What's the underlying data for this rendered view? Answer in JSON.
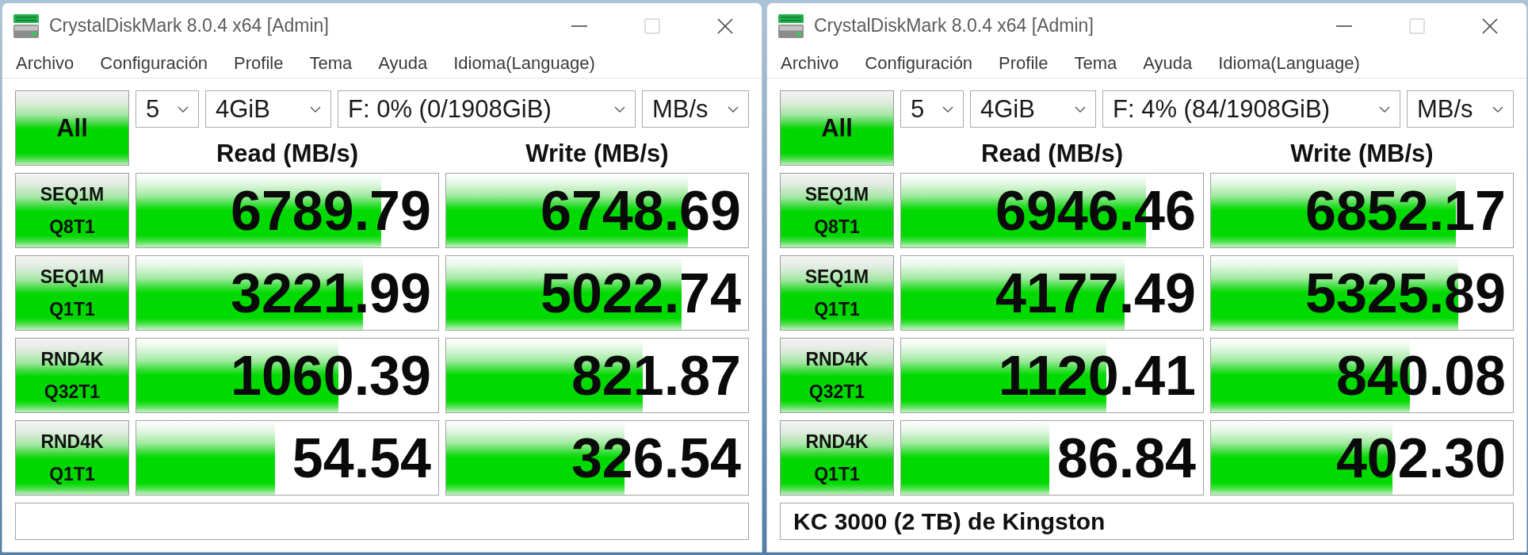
{
  "windows": [
    {
      "title": "CrystalDiskMark 8.0.4 x64 [Admin]",
      "controls": [
        {
          "kind": "minimize",
          "disabled": false
        },
        {
          "kind": "maximize",
          "disabled": true
        },
        {
          "kind": "close",
          "disabled": false
        }
      ],
      "menu": [
        "Archivo",
        "Configuración",
        "Profile",
        "Tema",
        "Ayuda",
        "Idioma(Language)"
      ],
      "all_button": "All",
      "settings": [
        {
          "kind": "count",
          "value": "5"
        },
        {
          "kind": "size",
          "value": "4GiB"
        },
        {
          "kind": "drive",
          "value": "F: 0% (0/1908GiB)"
        },
        {
          "kind": "unit",
          "value": "MB/s"
        }
      ],
      "columns": [
        "Read (MB/s)",
        "Write (MB/s)"
      ],
      "tests": [
        {
          "name": "SEQ1M",
          "params": "Q8T1",
          "read": {
            "value": "6789.79",
            "level": 0.81
          },
          "write": {
            "value": "6748.69",
            "level": 0.8
          }
        },
        {
          "name": "SEQ1M",
          "params": "Q1T1",
          "read": {
            "value": "3221.99",
            "level": 0.75
          },
          "write": {
            "value": "5022.74",
            "level": 0.78
          }
        },
        {
          "name": "RND4K",
          "params": "Q32T1",
          "read": {
            "value": "1060.39",
            "level": 0.67
          },
          "write": {
            "value": "821.87",
            "level": 0.65
          }
        },
        {
          "name": "RND4K",
          "params": "Q1T1",
          "read": {
            "value": "54.54",
            "level": 0.46
          },
          "write": {
            "value": "326.54",
            "level": 0.59
          }
        }
      ]
    },
    {
      "title": "CrystalDiskMark 8.0.4 x64 [Admin]",
      "controls": [
        {
          "kind": "minimize",
          "disabled": false
        },
        {
          "kind": "maximize",
          "disabled": true
        },
        {
          "kind": "close",
          "disabled": false
        }
      ],
      "menu": [
        "Archivo",
        "Configuración",
        "Profile",
        "Tema",
        "Ayuda",
        "Idioma(Language)"
      ],
      "all_button": "All",
      "settings": [
        {
          "kind": "count",
          "value": "5"
        },
        {
          "kind": "size",
          "value": "4GiB"
        },
        {
          "kind": "drive",
          "value": "F: 4% (84/1908GiB)"
        },
        {
          "kind": "unit",
          "value": "MB/s"
        }
      ],
      "columns": [
        "Read (MB/s)",
        "Write (MB/s)"
      ],
      "tests": [
        {
          "name": "SEQ1M",
          "params": "Q8T1",
          "read": {
            "value": "6946.46",
            "level": 0.81
          },
          "write": {
            "value": "6852.17",
            "level": 0.81
          }
        },
        {
          "name": "SEQ1M",
          "params": "Q1T1",
          "read": {
            "value": "4177.49",
            "level": 0.74
          },
          "write": {
            "value": "5325.89",
            "level": 0.82
          }
        },
        {
          "name": "RND4K",
          "params": "Q32T1",
          "read": {
            "value": "1120.41",
            "level": 0.68
          },
          "write": {
            "value": "840.08",
            "level": 0.66
          }
        },
        {
          "name": "RND4K",
          "params": "Q1T1",
          "read": {
            "value": "86.84",
            "level": 0.49
          },
          "write": {
            "value": "402.30",
            "level": 0.6
          }
        }
      ],
      "comment": "KC 3000 (2 TB) de Kingston"
    }
  ]
}
